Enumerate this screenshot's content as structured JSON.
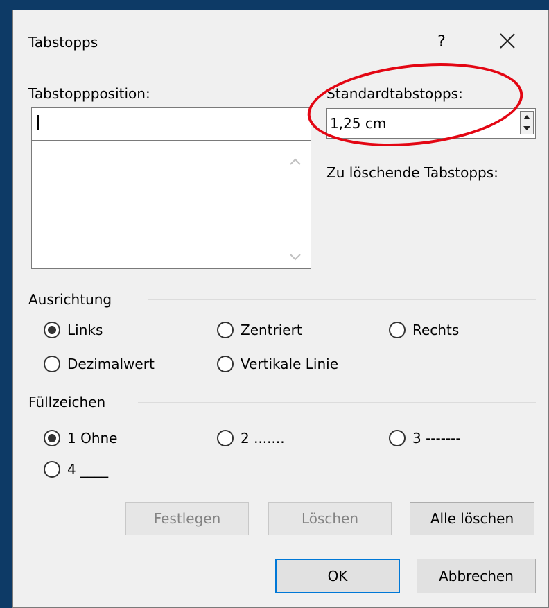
{
  "dialog": {
    "title": "Tabstopps",
    "help_label": "?"
  },
  "tabstop_position": {
    "label": "Tabstoppposition:",
    "value": ""
  },
  "default_tabs": {
    "label": "Standardtabstopps:",
    "value": "1,25 cm"
  },
  "clear_tabs_label": "Zu löschende Tabstopps:",
  "alignment": {
    "heading": "Ausrichtung",
    "options": [
      {
        "label": "Links",
        "selected": true
      },
      {
        "label": "Zentriert",
        "selected": false
      },
      {
        "label": "Rechts",
        "selected": false
      },
      {
        "label": "Dezimalwert",
        "selected": false
      },
      {
        "label": "Vertikale Linie",
        "selected": false
      }
    ]
  },
  "leader": {
    "heading": "Füllzeichen",
    "options": [
      {
        "label": "1 Ohne",
        "selected": true
      },
      {
        "label": "2 .......",
        "selected": false
      },
      {
        "label": "3 -------",
        "selected": false
      },
      {
        "label": "4 ____",
        "selected": false
      }
    ]
  },
  "buttons": {
    "set": "Festlegen",
    "clear": "Löschen",
    "clear_all": "Alle löschen",
    "ok": "OK",
    "cancel": "Abbrechen"
  },
  "colors": {
    "background": "#0d3a66",
    "highlight": "#e30613",
    "default_button_border": "#0078d7"
  }
}
